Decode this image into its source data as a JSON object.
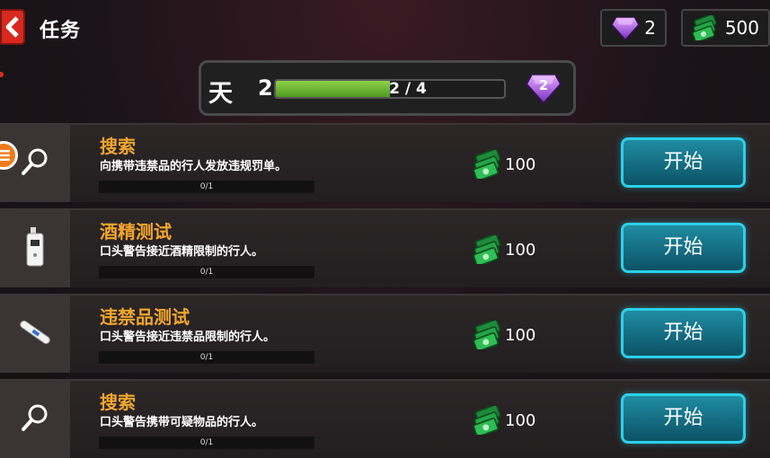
{
  "header": {
    "title": "任务",
    "back_icon": "chevron-left-icon"
  },
  "currency": {
    "gems": "2",
    "cash": "500"
  },
  "day_panel": {
    "label": "天",
    "day": "2",
    "progress_text": "2 / 4",
    "progress_fraction": 0.5,
    "reward_gems": "2"
  },
  "tasks": [
    {
      "title": "搜索",
      "desc": "向携带违禁品的行人发放违规罚单。",
      "progress": "0/1",
      "reward": "100",
      "button": "开始",
      "icon": "magnifier-icon"
    },
    {
      "title": "酒精测试",
      "desc": "口头警告接近酒精限制的行人。",
      "progress": "0/1",
      "reward": "100",
      "button": "开始",
      "icon": "breathalyzer-icon"
    },
    {
      "title": "违禁品测试",
      "desc": "口头警告接近违禁品限制的行人。",
      "progress": "0/1",
      "reward": "100",
      "button": "开始",
      "icon": "test-stick-icon"
    },
    {
      "title": "搜索",
      "desc": "口头警告携带可疑物品的行人。",
      "progress": "0/1",
      "reward": "100",
      "button": "开始",
      "icon": "magnifier-icon"
    }
  ]
}
